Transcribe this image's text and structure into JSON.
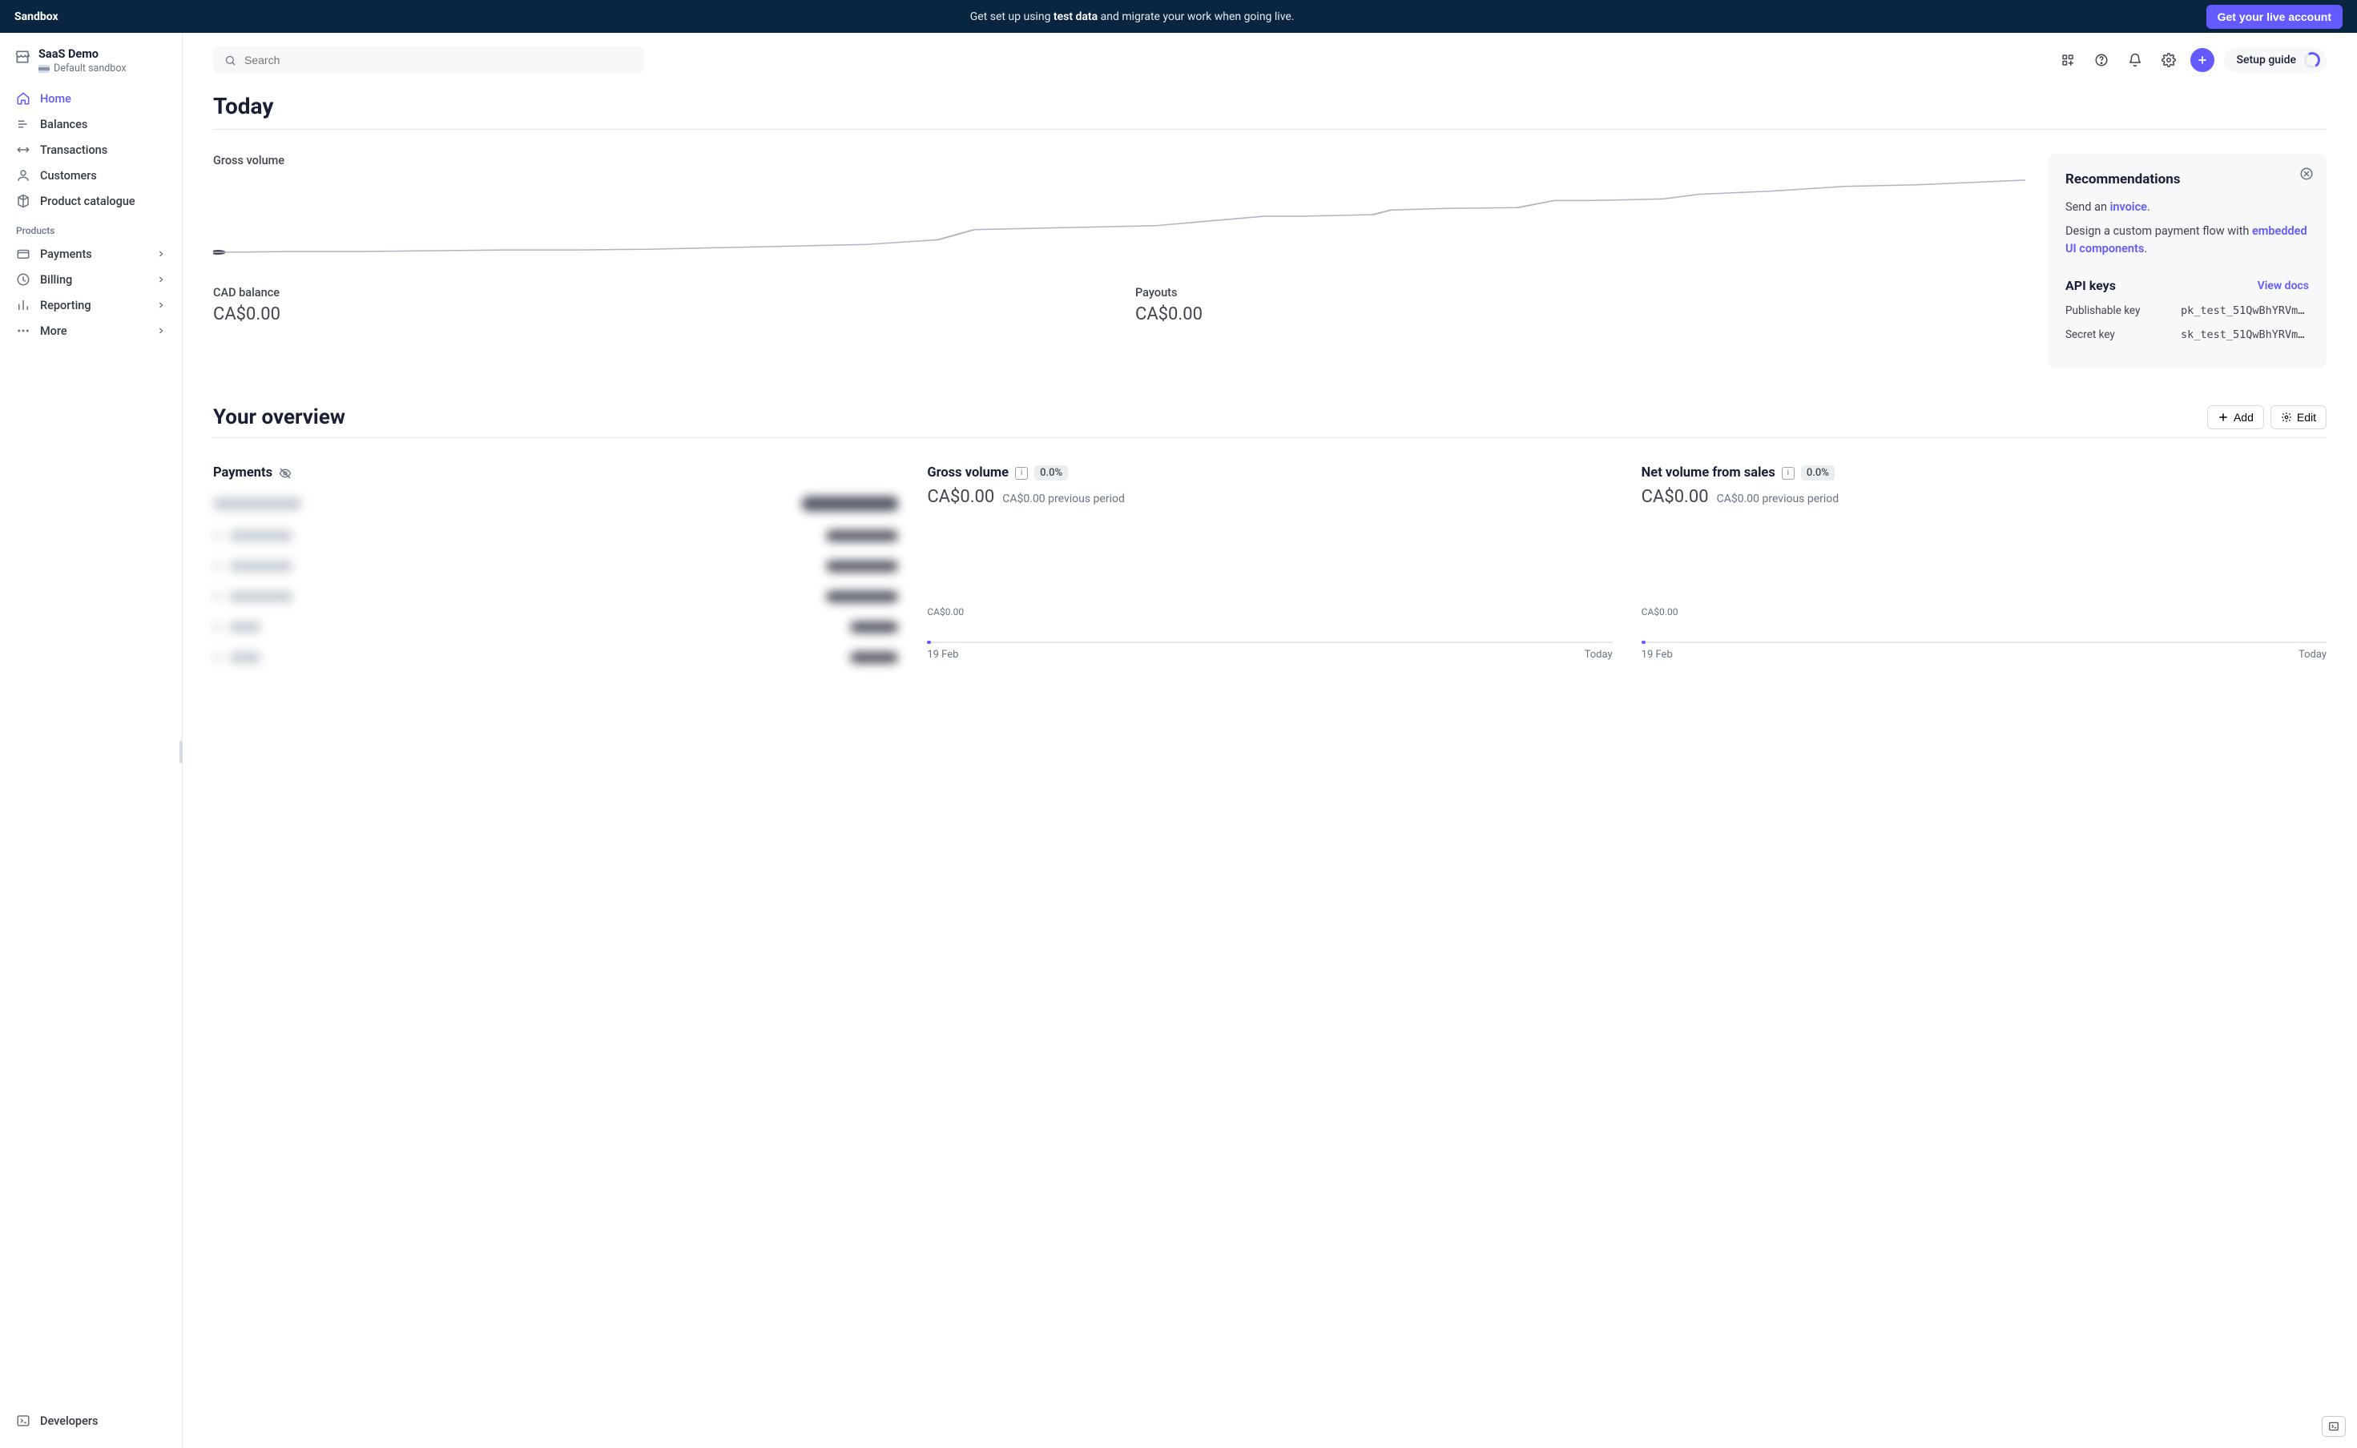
{
  "colors": {
    "accent": "#635bff",
    "banner": "#0a2540"
  },
  "banner": {
    "sandbox_label": "Sandbox",
    "center_pre": "Get set up using ",
    "center_bold": "test data",
    "center_post": " and migrate your work when going live.",
    "live_button": "Get your live account"
  },
  "account": {
    "name": "SaaS Demo",
    "subtext": "Default sandbox"
  },
  "nav": {
    "home": "Home",
    "balances": "Balances",
    "transactions": "Transactions",
    "customers": "Customers",
    "product_catalogue": "Product catalogue",
    "section_products": "Products",
    "payments": "Payments",
    "billing": "Billing",
    "reporting": "Reporting",
    "more": "More",
    "developers": "Developers"
  },
  "topbar": {
    "search_placeholder": "Search",
    "setup_guide": "Setup guide"
  },
  "page": {
    "title": "Today",
    "gross_label": "Gross volume",
    "cad_balance_label": "CAD balance",
    "cad_balance_value": "CA$0.00",
    "payouts_label": "Payouts",
    "payouts_value": "CA$0.00"
  },
  "chart_data": {
    "type": "line",
    "points": [
      [
        0,
        0.96
      ],
      [
        0.04,
        0.95
      ],
      [
        0.08,
        0.95
      ],
      [
        0.12,
        0.94
      ],
      [
        0.16,
        0.93
      ],
      [
        0.2,
        0.93
      ],
      [
        0.24,
        0.92
      ],
      [
        0.28,
        0.9
      ],
      [
        0.32,
        0.88
      ],
      [
        0.36,
        0.86
      ],
      [
        0.4,
        0.8
      ],
      [
        0.42,
        0.67
      ],
      [
        0.44,
        0.66
      ],
      [
        0.48,
        0.64
      ],
      [
        0.52,
        0.62
      ],
      [
        0.55,
        0.56
      ],
      [
        0.58,
        0.5
      ],
      [
        0.6,
        0.5
      ],
      [
        0.64,
        0.48
      ],
      [
        0.65,
        0.42
      ],
      [
        0.68,
        0.4
      ],
      [
        0.72,
        0.39
      ],
      [
        0.74,
        0.3
      ],
      [
        0.76,
        0.3
      ],
      [
        0.8,
        0.28
      ],
      [
        0.82,
        0.22
      ],
      [
        0.86,
        0.18
      ],
      [
        0.9,
        0.12
      ],
      [
        0.94,
        0.1
      ],
      [
        1.0,
        0.04
      ]
    ]
  },
  "reco": {
    "title": "Recommendations",
    "line1_pre": "Send an ",
    "line1_link": "invoice",
    "line1_post": ".",
    "line2_pre": "Design a custom payment flow with ",
    "line2_link": "embedded UI components",
    "line2_post": ".",
    "api_title": "API keys",
    "view_docs": "View docs",
    "pub_label": "Publishable key",
    "pub_value": "pk_test_51QwBhYRVmv…",
    "secret_label": "Secret key",
    "secret_value": "sk_test_51QwBhYRVmv…"
  },
  "overview": {
    "heading": "Your overview",
    "add": "Add",
    "edit": "Edit",
    "payments_title": "Payments",
    "gross_title": "Gross volume",
    "net_title": "Net volume from sales",
    "badge": "0.0%",
    "amount": "CA$0.00",
    "prev": "CA$0.00 previous period",
    "mini_amount": "CA$0.00",
    "axis_left": "19 Feb",
    "axis_right": "Today"
  }
}
